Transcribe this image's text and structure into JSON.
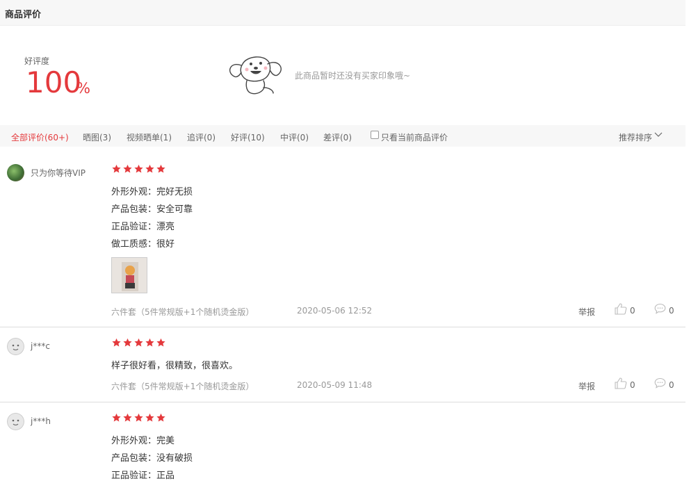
{
  "section": {
    "title": "商品评价"
  },
  "summary": {
    "good_rate_label": "好评度",
    "good_rate_value": "100",
    "good_rate_unit": "%",
    "impressions_empty": "此商品暂时还没有买家印象哦~"
  },
  "filters": {
    "tabs": [
      {
        "label": "全部评价(60+)",
        "active": true
      },
      {
        "label": "晒图(3)"
      },
      {
        "label": "视频晒单(1)"
      },
      {
        "label": "追评(0)"
      },
      {
        "label": "好评(10)"
      },
      {
        "label": "中评(0)"
      },
      {
        "label": "差评(0)"
      }
    ],
    "only_current_label": "只看当前商品评价",
    "sort_label": "推荐排序"
  },
  "reviews": [
    {
      "user": "只为你等待VIP",
      "rating": 5,
      "lines": [
        "外形外观：完好无损",
        "产品包装：安全可靠",
        "正品验证：漂亮",
        "做工质感：很好"
      ],
      "spec": "六件套（5件常规版+1个随机烫金版）",
      "date": "2020-05-06 12:52",
      "report_label": "举报",
      "likes": "0",
      "comments": "0"
    },
    {
      "user": "j***c",
      "rating": 5,
      "lines": [
        "样子很好看，很精致，很喜欢。"
      ],
      "spec": "六件套（5件常规版+1个随机烫金版）",
      "date": "2020-05-09 11:48",
      "report_label": "举报",
      "likes": "0",
      "comments": "0"
    },
    {
      "user": "j***h",
      "rating": 5,
      "lines": [
        "外形外观：完美",
        "产品包装：没有破损",
        "正品验证：正品"
      ]
    }
  ],
  "colors": {
    "accent": "#e4393c",
    "muted": "#999999",
    "bar_bg": "#f7f7f7"
  }
}
